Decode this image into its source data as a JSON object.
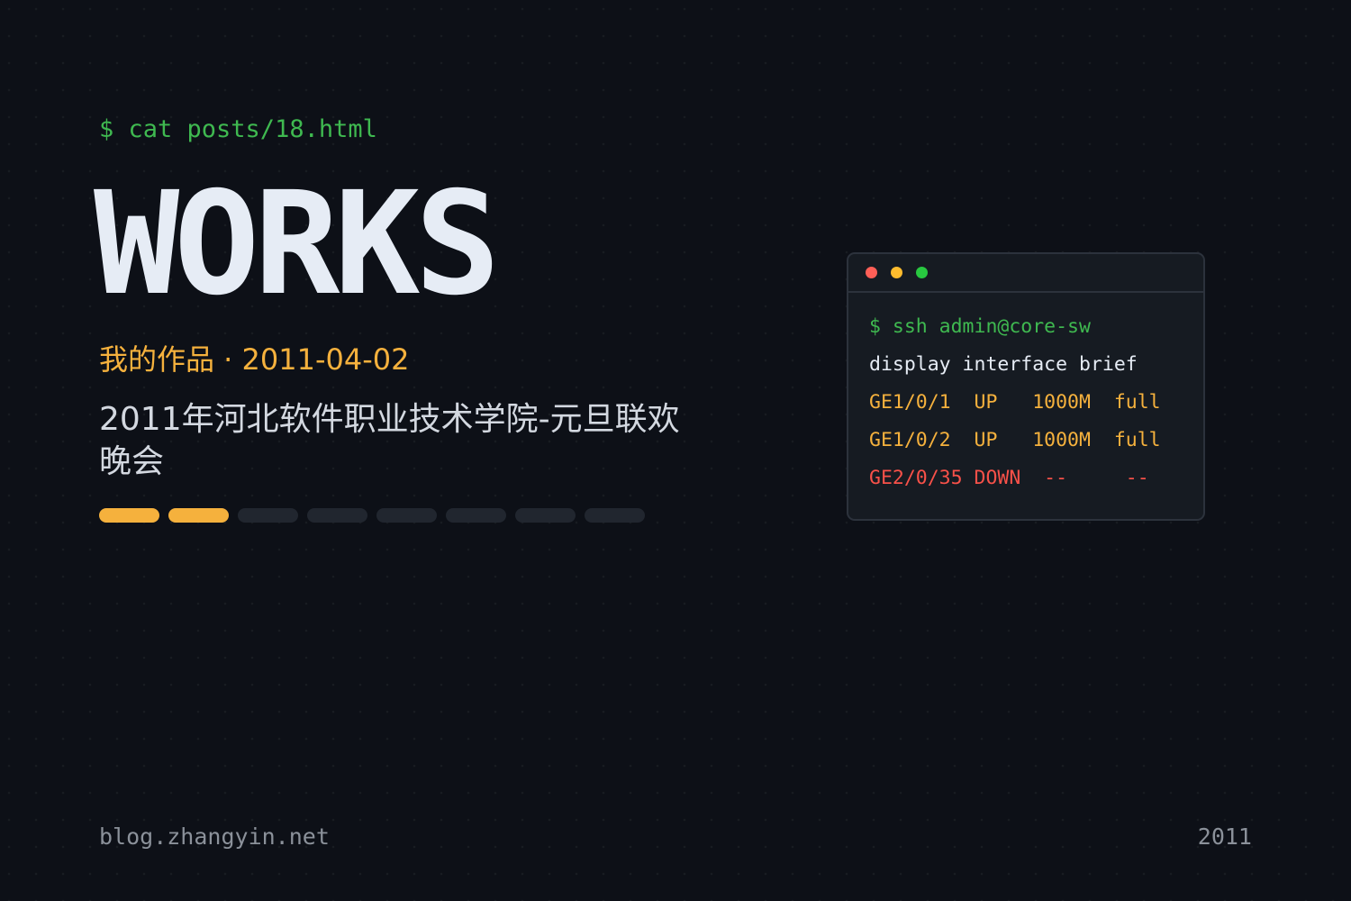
{
  "prompt": "$ cat posts/18.html",
  "title": "WORKS",
  "subtitle": "我的作品 · 2011-04-02",
  "description": "2011年河北软件职业技术学院-元旦联欢晚会",
  "progress": {
    "filled": 2,
    "total": 8
  },
  "terminal": {
    "lines": [
      {
        "text": "$ ssh admin@core-sw",
        "style": "cmd"
      },
      {
        "text": "display interface brief",
        "style": "plain"
      },
      {
        "text": "GE1/0/1  UP   1000M  full",
        "style": "up"
      },
      {
        "text": "GE1/0/2  UP   1000M  full",
        "style": "up"
      },
      {
        "text": "GE2/0/35 DOWN  --     --",
        "style": "down"
      }
    ]
  },
  "footer": {
    "site": "blog.zhangyin.net",
    "year": "2011"
  },
  "colors": {
    "background": "#0d1017",
    "accent": "#f5b13d",
    "prompt_green": "#3fb950",
    "error_red": "#f85149"
  }
}
